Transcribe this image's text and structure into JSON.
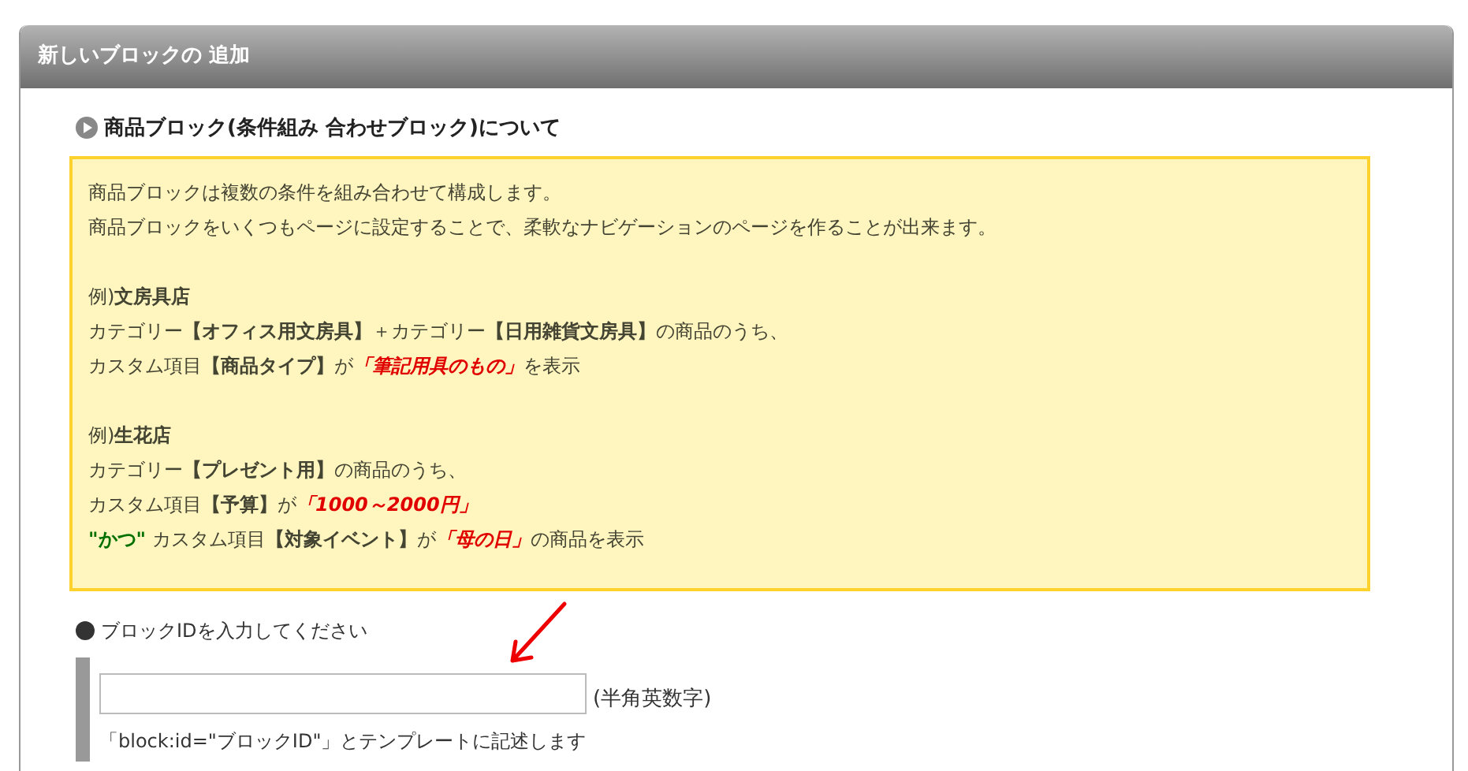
{
  "panel": {
    "title": "新しいブロックの 追加"
  },
  "section": {
    "title": "商品ブロック(条件組み 合わせブロック)について"
  },
  "info_blocks": [
    {
      "lines": [
        [
          {
            "kind": "plain",
            "text": "商品ブロックは複数の条件を組み合わせて構成します。"
          }
        ],
        [
          {
            "kind": "plain",
            "text": "商品ブロックをいくつもページに設定することで、柔軟なナビゲーションのページを作ることが出来ます。"
          }
        ]
      ]
    },
    {
      "lines": [
        [
          {
            "kind": "plain",
            "text": "例)"
          },
          {
            "kind": "bold",
            "text": "文房具店"
          }
        ],
        [
          {
            "kind": "plain",
            "text": "カテゴリー"
          },
          {
            "kind": "bold",
            "text": "【オフィス用文房具】"
          },
          {
            "kind": "plain",
            "text": "＋カテゴリー"
          },
          {
            "kind": "bold",
            "text": "【日用雑貨文房具】"
          },
          {
            "kind": "plain",
            "text": "の商品のうち、"
          }
        ],
        [
          {
            "kind": "plain",
            "text": "カスタム項目"
          },
          {
            "kind": "bold",
            "text": "【商品タイプ】"
          },
          {
            "kind": "plain",
            "text": "が"
          },
          {
            "kind": "emphasis",
            "text": "「筆記用具のもの」"
          },
          {
            "kind": "plain",
            "text": "を表示"
          }
        ]
      ]
    },
    {
      "lines": [
        [
          {
            "kind": "plain",
            "text": "例)"
          },
          {
            "kind": "bold",
            "text": "生花店"
          }
        ],
        [
          {
            "kind": "plain",
            "text": "カテゴリー"
          },
          {
            "kind": "bold",
            "text": "【プレゼント用】"
          },
          {
            "kind": "plain",
            "text": "の商品のうち、"
          }
        ],
        [
          {
            "kind": "plain",
            "text": "カスタム項目"
          },
          {
            "kind": "bold",
            "text": "【予算】"
          },
          {
            "kind": "plain",
            "text": "が"
          },
          {
            "kind": "emphasis",
            "text": "「1000～2000円」"
          }
        ],
        [
          {
            "kind": "conjunction",
            "text": "\"かつ\""
          },
          {
            "kind": "plain",
            "text": " カスタム項目"
          },
          {
            "kind": "bold",
            "text": "【対象イベント】"
          },
          {
            "kind": "plain",
            "text": "が"
          },
          {
            "kind": "emphasis",
            "text": "「母の日」"
          },
          {
            "kind": "plain",
            "text": "の商品を表示"
          }
        ]
      ]
    }
  ],
  "block_id": {
    "label": "ブロックIDを入力してください",
    "hint": "(半角英数字)",
    "note": "「block:id=\"ブロックID\"」とテンプレートに記述します"
  }
}
